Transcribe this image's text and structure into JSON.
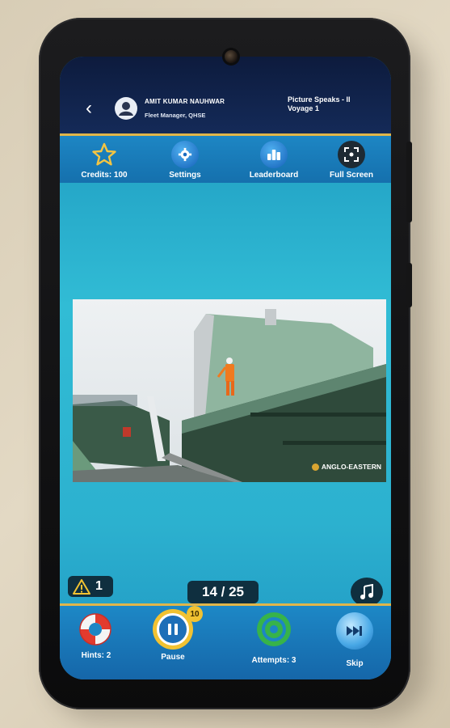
{
  "header": {
    "back_icon": "chevron-left-icon",
    "user_name": "AMIT KUMAR NAUHWAR",
    "user_role": "Fleet Manager, QHSE",
    "game_title_line1": "Picture Speaks - II",
    "game_title_line2": "Voyage 1"
  },
  "toolbar": {
    "credits_label": "Credits: 100",
    "settings_label": "Settings",
    "leaderboard_label": "Leaderboard",
    "fullscreen_label": "Full Screen"
  },
  "image": {
    "watermark": "ANGLO-EASTERN"
  },
  "status": {
    "warning_count": "1",
    "progress": "14 / 25",
    "music_icon": "music-note-icon"
  },
  "actions": {
    "hints_label": "Hints: 2",
    "pause_label": "Pause",
    "pause_badge": "10",
    "attempts_label": "Attempts: 3",
    "skip_label": "Skip"
  },
  "colors": {
    "accent_gold": "#e0b64a",
    "header_navy": "#142a58",
    "toolbar_blue": "#1d86c4",
    "screen_cyan": "#31bcd5"
  }
}
